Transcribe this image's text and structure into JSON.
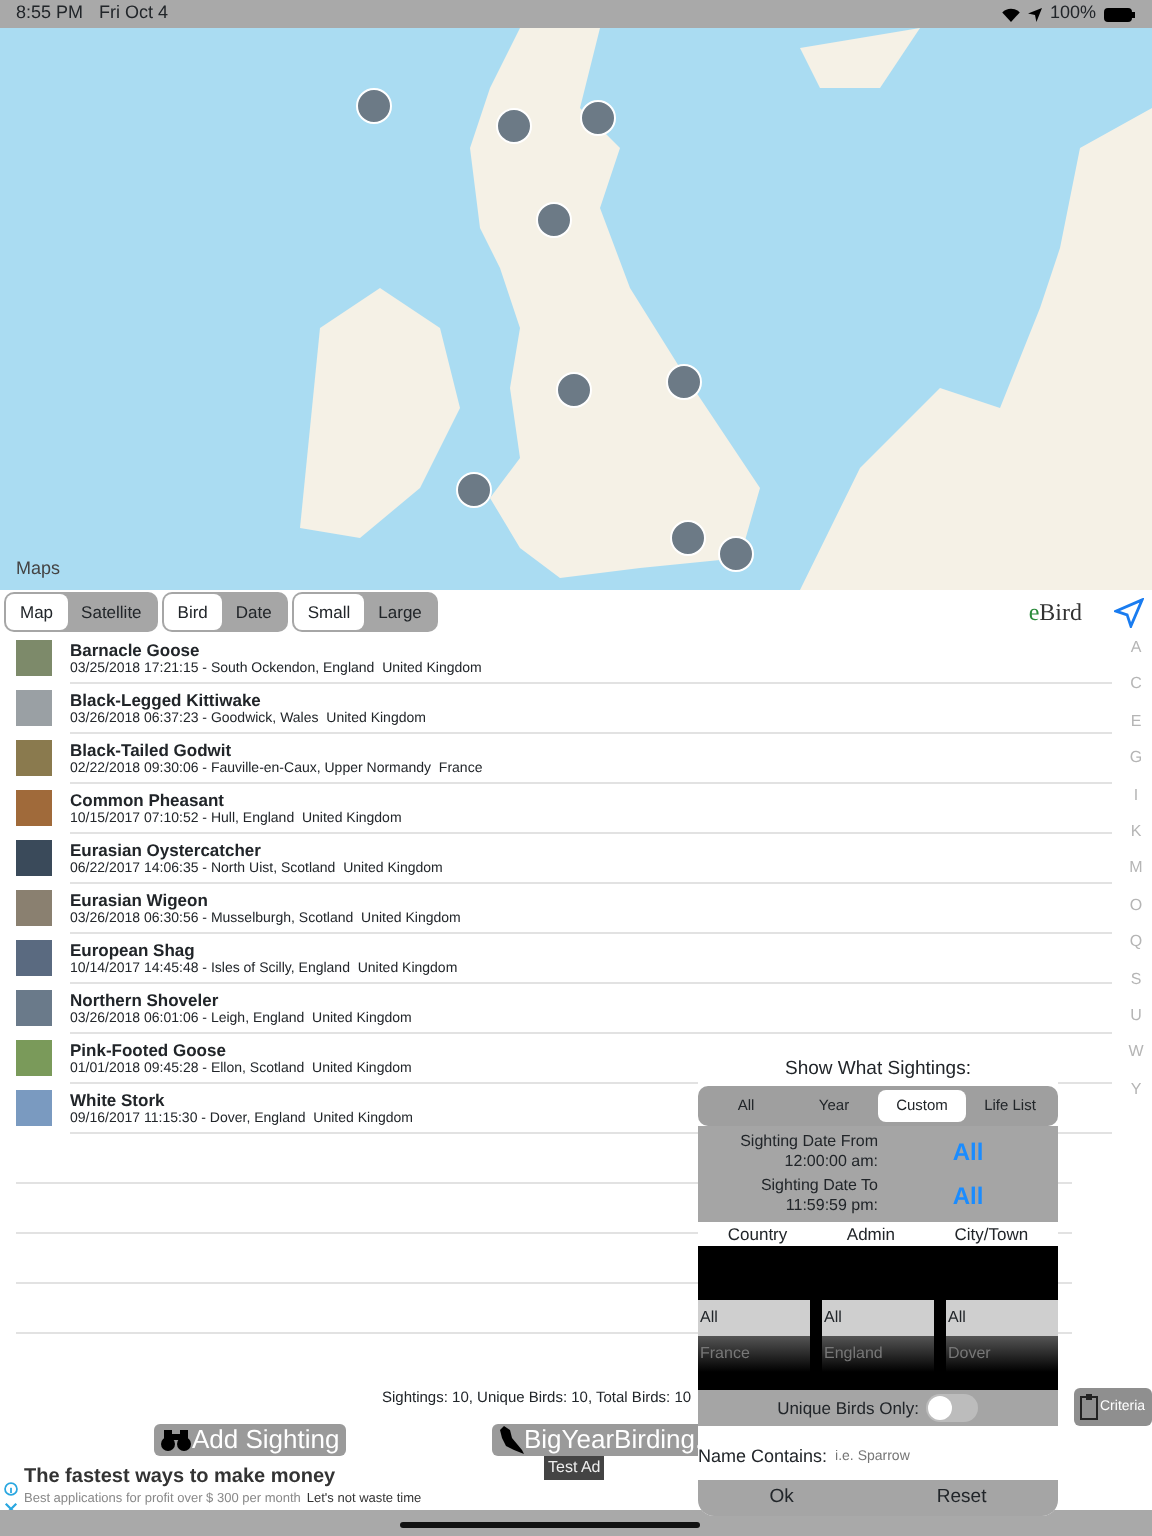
{
  "status_bar": {
    "time": "8:55 PM",
    "date": "Fri Oct 4",
    "battery": "100%"
  },
  "map": {
    "logo": "Maps"
  },
  "toolbar": {
    "groups": [
      [
        {
          "label": "Map",
          "selected": true
        },
        {
          "label": "Satellite",
          "selected": false
        }
      ],
      [
        {
          "label": "Bird",
          "selected": true
        },
        {
          "label": "Date",
          "selected": false
        }
      ],
      [
        {
          "label": "Small",
          "selected": true
        },
        {
          "label": "Large",
          "selected": false
        }
      ]
    ],
    "brand_prefix": "e",
    "brand_rest": "Bird"
  },
  "sightings": [
    {
      "name": "Barnacle Goose",
      "detail": "03/25/2018 17:21:15 - South Ockendon, England  United Kingdom"
    },
    {
      "name": "Black-Legged Kittiwake",
      "detail": "03/26/2018 06:37:23 - Goodwick, Wales  United Kingdom"
    },
    {
      "name": "Black-Tailed Godwit",
      "detail": "02/22/2018 09:30:06 - Fauville-en-Caux, Upper Normandy  France"
    },
    {
      "name": "Common Pheasant",
      "detail": "10/15/2017 07:10:52 - Hull, England  United Kingdom"
    },
    {
      "name": "Eurasian Oystercatcher",
      "detail": "06/22/2017 14:06:35 - North Uist, Scotland  United Kingdom"
    },
    {
      "name": "Eurasian Wigeon",
      "detail": "03/26/2018 06:30:56 - Musselburgh, Scotland  United Kingdom"
    },
    {
      "name": "European Shag",
      "detail": "10/14/2017 14:45:48 - Isles of Scilly, England  United Kingdom"
    },
    {
      "name": "Northern Shoveler",
      "detail": "03/26/2018 06:01:06 - Leigh, England  United Kingdom"
    },
    {
      "name": "Pink-Footed Goose",
      "detail": "01/01/2018 09:45:28 - Ellon, Scotland  United Kingdom"
    },
    {
      "name": "White Stork",
      "detail": "09/16/2017 11:15:30 - Dover, England  United Kingdom"
    }
  ],
  "index_letters": [
    "A",
    "C",
    "E",
    "G",
    "I",
    "K",
    "M",
    "O",
    "Q",
    "S",
    "U",
    "W",
    "Y"
  ],
  "summary": "Sightings: 10, Unique Birds: 10, Total Birds: 10",
  "buttons": [
    {
      "kind": "binoculars",
      "label": "Add Sighting"
    },
    {
      "kind": "bird",
      "label": "BigYearBirding."
    }
  ],
  "criteria_button": "Criteria",
  "ad": {
    "badge": "Test Ad",
    "title": "The fastest ways to make money",
    "text": "Best applications for profit over $ 300 per month",
    "link": "Let's not waste time"
  },
  "filter_dialog": {
    "title": "Show What Sightings:",
    "tabs": [
      {
        "label": "All",
        "selected": false
      },
      {
        "label": "Year",
        "selected": false
      },
      {
        "label": "Custom",
        "selected": true
      },
      {
        "label": "Life List",
        "selected": false
      }
    ],
    "dates": [
      {
        "label": "Sighting Date From 12:00:00 am:",
        "value": "All"
      },
      {
        "label": "Sighting Date To 11:59:59 pm:",
        "value": "All"
      }
    ],
    "pickers": [
      {
        "heading": "Country",
        "selected_value": "All",
        "next_value": "France"
      },
      {
        "heading": "Admin",
        "selected_value": "All",
        "next_value": "England"
      },
      {
        "heading": "City/Town",
        "selected_value": "All",
        "next_value": "Dover"
      }
    ],
    "unique_only": {
      "label": "Unique Birds Only:",
      "on": false
    },
    "name_contains": {
      "label": "Name Contains:",
      "placeholder": "i.e. Sparrow"
    },
    "actions": [
      "Ok",
      "Reset"
    ]
  }
}
